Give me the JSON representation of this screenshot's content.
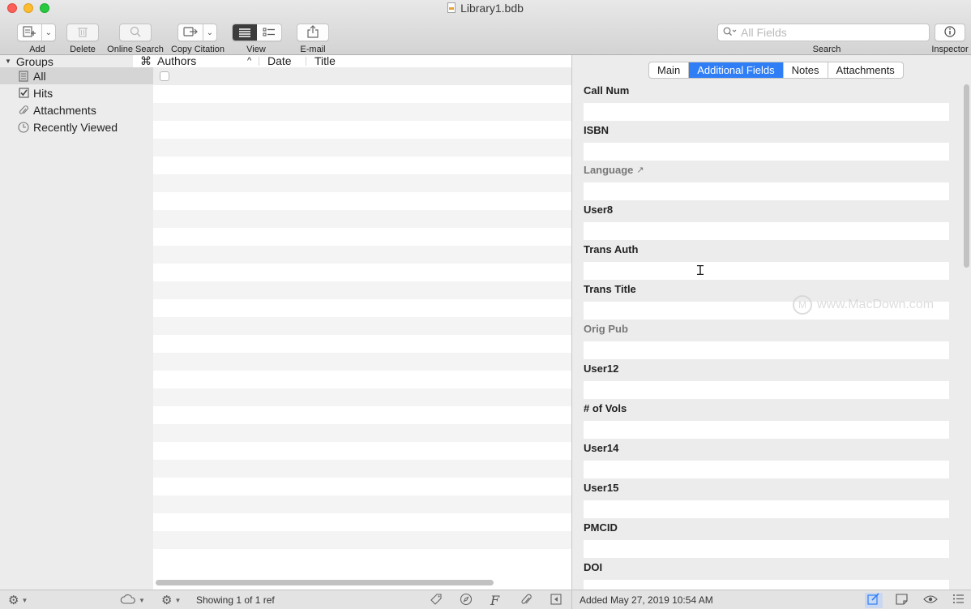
{
  "window": {
    "title": "Library1.bdb"
  },
  "toolbar": {
    "add_label": "Add",
    "delete_label": "Delete",
    "online_search_label": "Online Search",
    "copy_citation_label": "Copy Citation",
    "view_label": "View",
    "email_label": "E-mail",
    "search_label": "Search",
    "search_placeholder": "All Fields",
    "inspector_label": "Inspector"
  },
  "sidebar": {
    "groups_header": "Groups",
    "items": [
      {
        "label": "All",
        "icon": "library-icon",
        "selected": true
      },
      {
        "label": "Hits",
        "icon": "checkbox-icon"
      },
      {
        "label": "Attachments",
        "icon": "paperclip-icon"
      },
      {
        "label": "Recently Viewed",
        "icon": "clock-icon"
      }
    ]
  },
  "table": {
    "columns": [
      "⌘",
      "Authors",
      "Date",
      "Title"
    ],
    "sort_indicator": "^"
  },
  "inspector": {
    "tabs": [
      {
        "label": "Main"
      },
      {
        "label": "Additional Fields",
        "active": true
      },
      {
        "label": "Notes"
      },
      {
        "label": "Attachments"
      }
    ],
    "fields": [
      {
        "label": "Call Num",
        "value": ""
      },
      {
        "label": "ISBN",
        "value": ""
      },
      {
        "label": "Language",
        "value": "",
        "dim": true,
        "link_icon": "↗"
      },
      {
        "label": "User8",
        "value": ""
      },
      {
        "label": "Trans Auth",
        "value": ""
      },
      {
        "label": "Trans Title",
        "value": ""
      },
      {
        "label": "Orig Pub",
        "value": "",
        "dim": true
      },
      {
        "label": "User12",
        "value": ""
      },
      {
        "label": "# of Vols",
        "value": ""
      },
      {
        "label": "User14",
        "value": ""
      },
      {
        "label": "User15",
        "value": ""
      },
      {
        "label": "PMCID",
        "value": ""
      },
      {
        "label": "DOI",
        "value": ""
      }
    ]
  },
  "watermark": {
    "text": "www.MacDown.com",
    "mark": "M"
  },
  "statusbar": {
    "showing": "Showing 1 of 1 ref",
    "added": "Added May 27, 2019 10:54 AM"
  },
  "colors": {
    "accent": "#2f7ef6",
    "sidebar_bg": "#ececec",
    "selected_row": "#d5d5d5"
  }
}
